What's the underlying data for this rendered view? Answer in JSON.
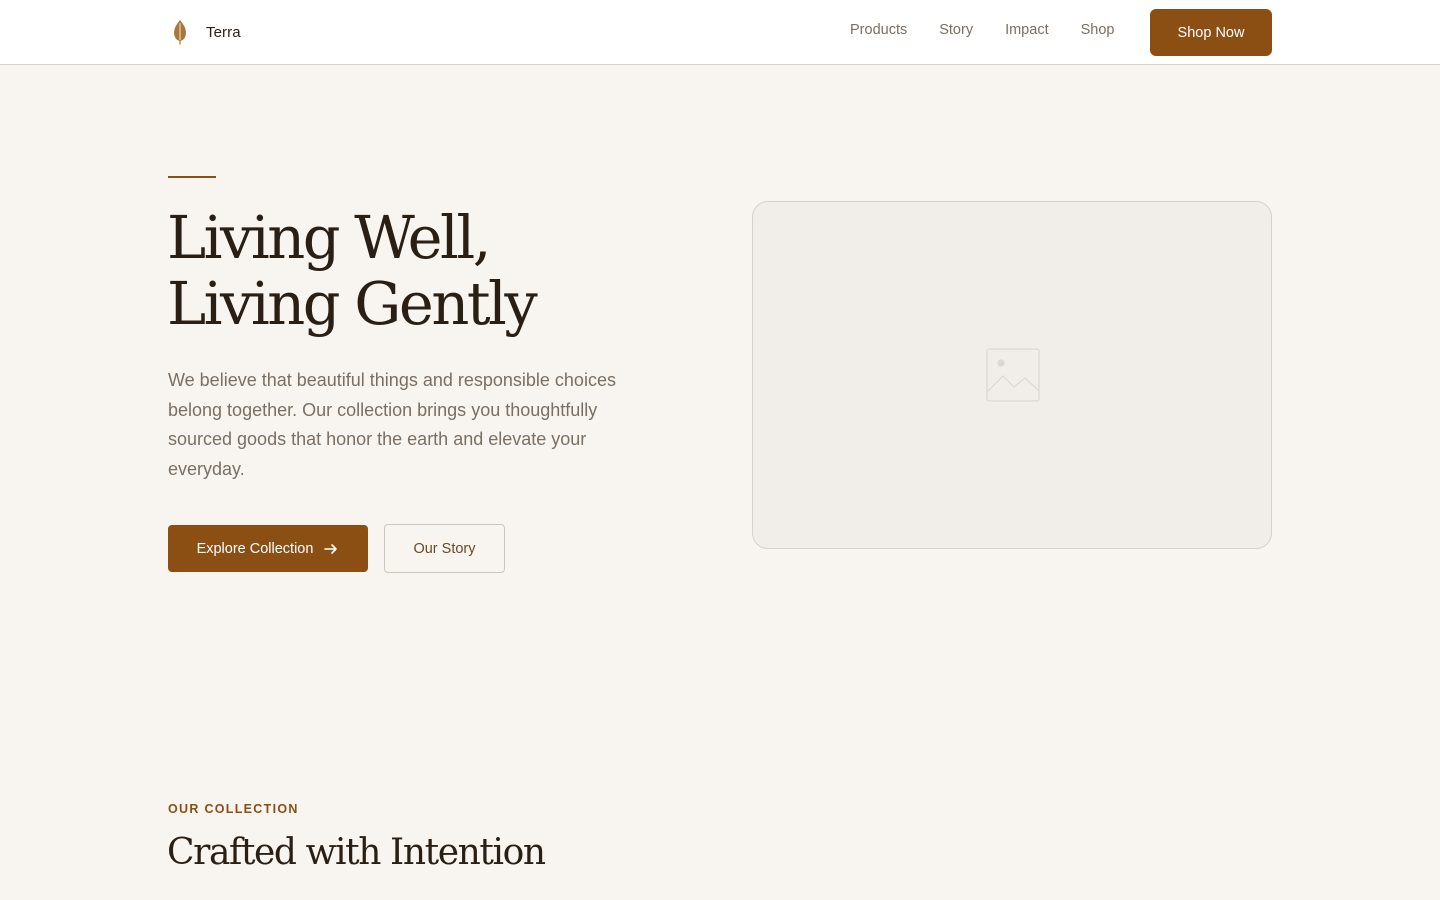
{
  "header": {
    "brand": "Terra",
    "nav": [
      "Products",
      "Story",
      "Impact",
      "Shop"
    ],
    "cta_label": "Shop Now"
  },
  "hero": {
    "title_line1": "Living Well,",
    "title_line2": "Living Gently",
    "description": "We believe that beautiful things and responsible choices belong together. Our collection brings you thoughtfully sourced goods that honor the earth and elevate your everyday.",
    "primary_label": "Explore Collection",
    "secondary_label": "Our Story",
    "image_icon": "image-placeholder-icon"
  },
  "collection": {
    "eyebrow": "OUR COLLECTION",
    "title": "Crafted with Intention"
  },
  "colors": {
    "accent": "#8b4f14",
    "background": "#f8f5f1",
    "text": "#2a1f14",
    "muted": "#7a6f63"
  }
}
